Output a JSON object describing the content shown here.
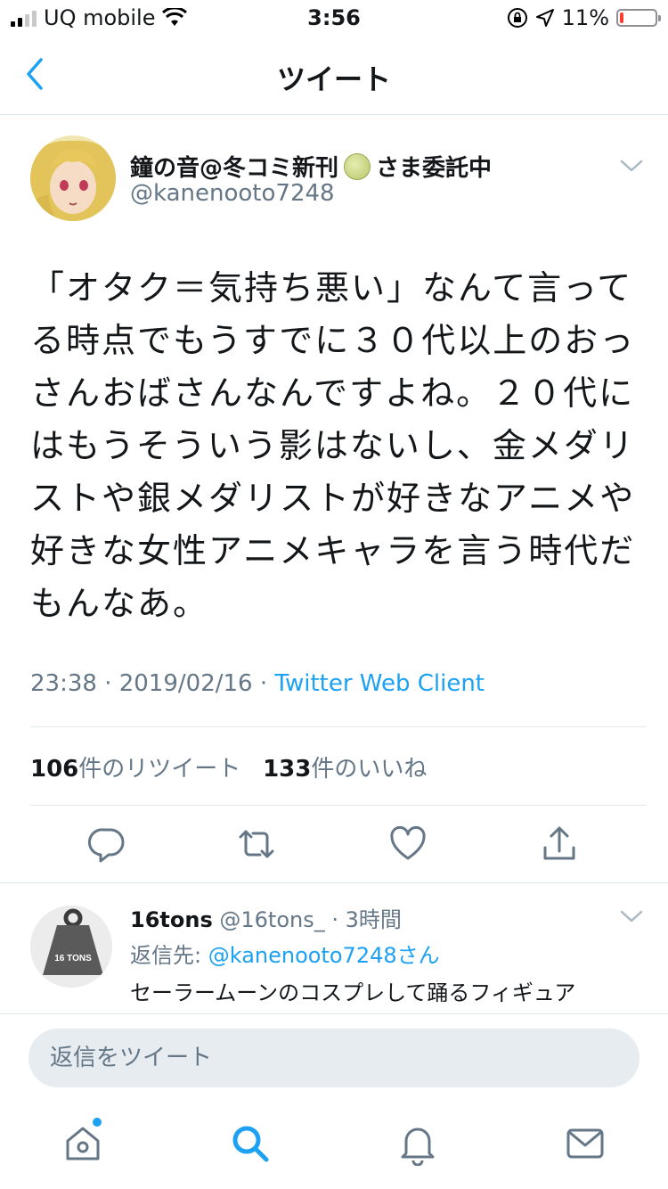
{
  "status_bar": {
    "carrier": "UQ mobile",
    "time": "3:56",
    "battery": "11%",
    "battery_level": 0.11
  },
  "nav": {
    "title": "ツイート",
    "back_icon": "chevron-left-icon"
  },
  "tweet": {
    "display_name": "鐘の音@冬コミ新刊",
    "display_name_suffix": "さま委託中",
    "handle": "@kanenooto7248",
    "text": "「オタク＝気持ち悪い」なんて言ってる時点でもうすでに３０代以上のおっさんおばさんなんですよね。２０代にはもうそういう影はないし、金メダリストや銀メダリストが好きなアニメや好きな女性アニメキャラを言う時代だもんなあ。",
    "timestamp": "23:38 · 2019/02/16 · ",
    "client": "Twitter Web Client",
    "retweets_count": "106",
    "retweets_label": "件のリツイート",
    "likes_count": "133",
    "likes_label": "件のいいね"
  },
  "actions": [
    "reply-icon",
    "retweet-icon",
    "like-icon",
    "share-icon"
  ],
  "reply": {
    "name": "16tons",
    "handle": "@16tons_",
    "time": "· 3時間",
    "reply_to_label": "返信先: ",
    "reply_to_user": "@kanenooto7248さん",
    "text": "セーラームーンのコスプレして踊るフィギュア",
    "avatar_text": "16 TONS"
  },
  "compose": {
    "placeholder": "返信をツイート"
  },
  "tabs": [
    "home-icon",
    "search-icon",
    "notifications-icon",
    "messages-icon"
  ],
  "colors": {
    "accent": "#1da1f2",
    "text": "#14171a",
    "muted": "#657786",
    "divider": "#e1e8ed",
    "battery_low": "#ff3b30"
  }
}
